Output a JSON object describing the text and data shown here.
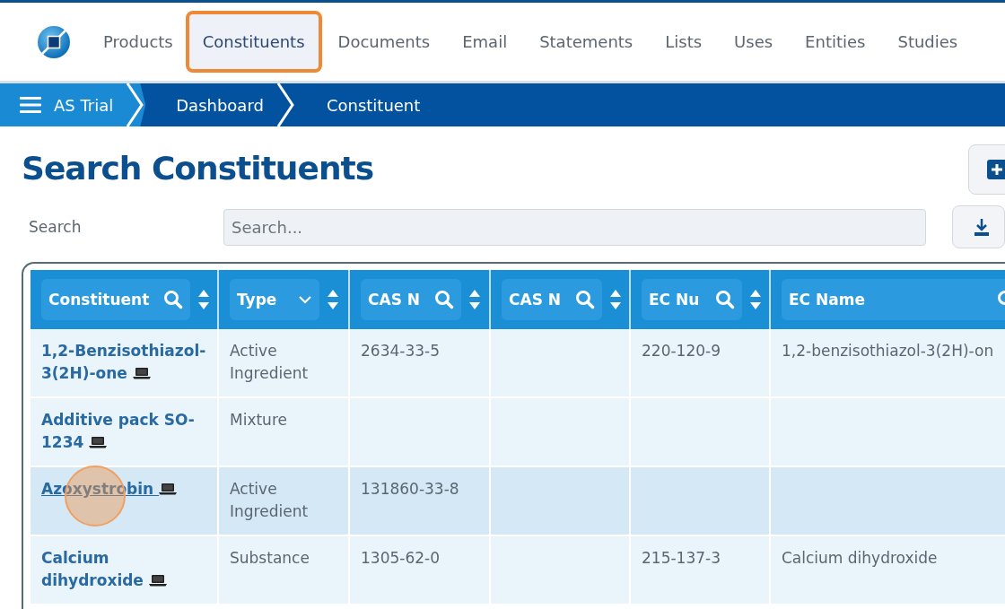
{
  "nav": {
    "items": [
      {
        "label": "Products",
        "selected": false
      },
      {
        "label": "Constituents",
        "selected": true
      },
      {
        "label": "Documents",
        "selected": false
      },
      {
        "label": "Email",
        "selected": false
      },
      {
        "label": "Statements",
        "selected": false
      },
      {
        "label": "Lists",
        "selected": false
      },
      {
        "label": "Uses",
        "selected": false
      },
      {
        "label": "Entities",
        "selected": false
      },
      {
        "label": "Studies",
        "selected": false
      }
    ]
  },
  "breadcrumb": [
    {
      "label": "AS Trial",
      "kind": "menu"
    },
    {
      "label": "Dashboard",
      "kind": "link"
    },
    {
      "label": "Constituent",
      "kind": "current"
    }
  ],
  "title": "Search Constituents",
  "search": {
    "label": "Search",
    "placeholder": "Search..."
  },
  "table": {
    "columns": [
      {
        "label": "Constituent",
        "kind": "search"
      },
      {
        "label": "Type",
        "kind": "dropdown"
      },
      {
        "label": "CAS N",
        "kind": "search"
      },
      {
        "label": "CAS N",
        "kind": "search"
      },
      {
        "label": "EC Nu",
        "kind": "search"
      },
      {
        "label": "EC Name",
        "kind": "search"
      }
    ],
    "rows": [
      {
        "hovered": false,
        "cells": [
          "1,2-Benzisothiazol-3(2H)-one",
          "Active Ingredient",
          "2634-33-5",
          "",
          "220-120-9",
          "1,2-benzisothiazol-3(2H)-on"
        ]
      },
      {
        "hovered": false,
        "cells": [
          "Additive pack SO-1234",
          "Mixture",
          "",
          "",
          "",
          ""
        ]
      },
      {
        "hovered": true,
        "cells": [
          "Azoxystrobin",
          "Active Ingredient",
          "131860-33-8",
          "",
          "",
          ""
        ]
      },
      {
        "hovered": false,
        "cells": [
          "Calcium dihydroxide",
          "Substance",
          "1305-62-0",
          "",
          "215-137-3",
          "Calcium dihydroxide"
        ]
      }
    ]
  }
}
